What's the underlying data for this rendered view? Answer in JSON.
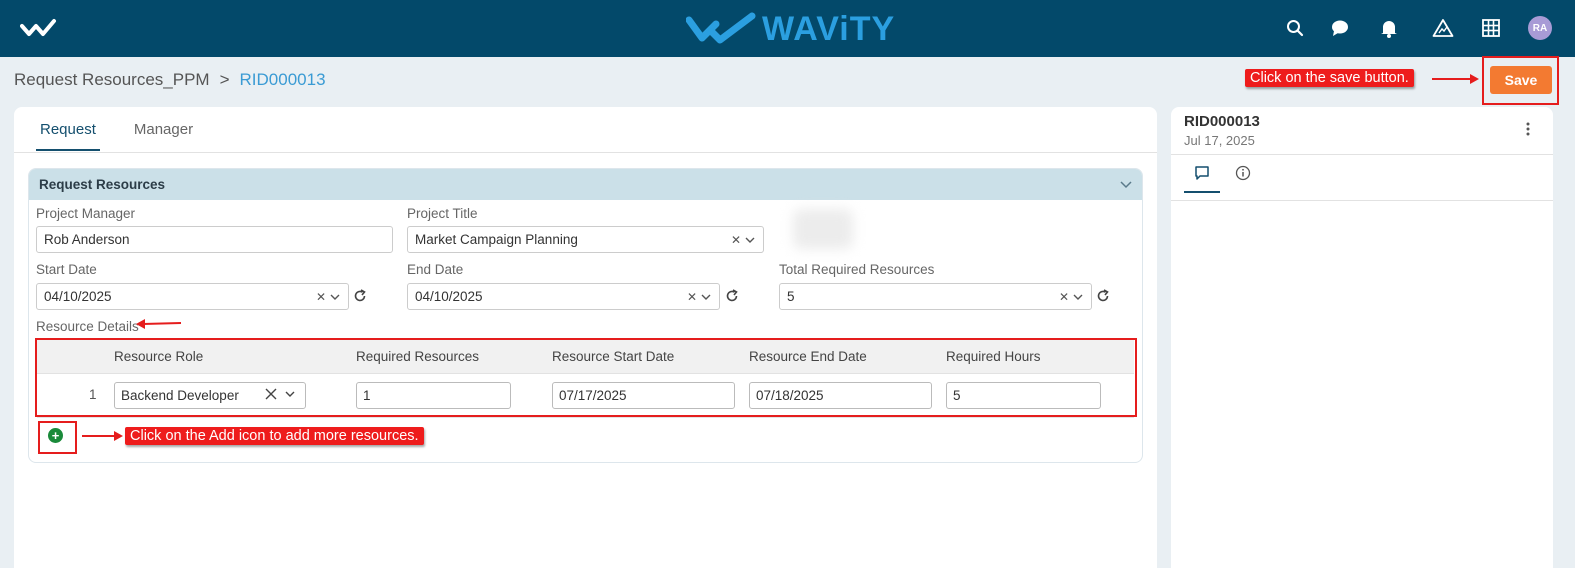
{
  "header": {
    "brand_name": "WAViTY",
    "avatar_initials": "RA",
    "icons": [
      "menu-logo-icon",
      "search-icon",
      "chat-icon",
      "bell-icon",
      "alert-triangle-icon",
      "apps-grid-icon"
    ]
  },
  "breadcrumb": {
    "parent": "Request Resources_PPM",
    "separator": ">",
    "current": "RID000013"
  },
  "toolbar": {
    "save_label": "Save"
  },
  "annotations": {
    "save": "Click on the save button.",
    "add": "Click on the Add icon to add more resources."
  },
  "tabs": [
    {
      "label": "Request",
      "active": true
    },
    {
      "label": "Manager",
      "active": false
    }
  ],
  "section": {
    "title": "Request Resources",
    "fields": {
      "project_manager": {
        "label": "Project Manager",
        "value": "Rob Anderson"
      },
      "project_title": {
        "label": "Project Title",
        "value": "Market Campaign Planning"
      },
      "start_date": {
        "label": "Start Date",
        "value": "04/10/2025"
      },
      "end_date": {
        "label": "End Date",
        "value": "04/10/2025"
      },
      "total_resources": {
        "label": "Total Required Resources",
        "value": "5"
      }
    },
    "resource_details_label": "Resource Details",
    "table": {
      "columns": [
        "Resource Role",
        "Required Resources",
        "Resource Start Date",
        "Resource End Date",
        "Required Hours"
      ],
      "rows": [
        {
          "num": "1",
          "role": "Backend Developer",
          "required_resources": "1",
          "start_date": "07/17/2025",
          "end_date": "07/18/2025",
          "hours": "5"
        }
      ]
    },
    "add_symbol": "+"
  },
  "side_panel": {
    "title": "RID000013",
    "date": "Jul 17, 2025",
    "tabs": [
      "comment-icon",
      "info-icon"
    ]
  },
  "colors": {
    "header_bg": "#03496a",
    "brand": "#2b9fe0",
    "save_button": "#f37a31",
    "annotation": "#ee1c1c",
    "section_head": "#cbe0e8",
    "link": "#3a9bd4",
    "add_icon": "#1a8a3a"
  }
}
